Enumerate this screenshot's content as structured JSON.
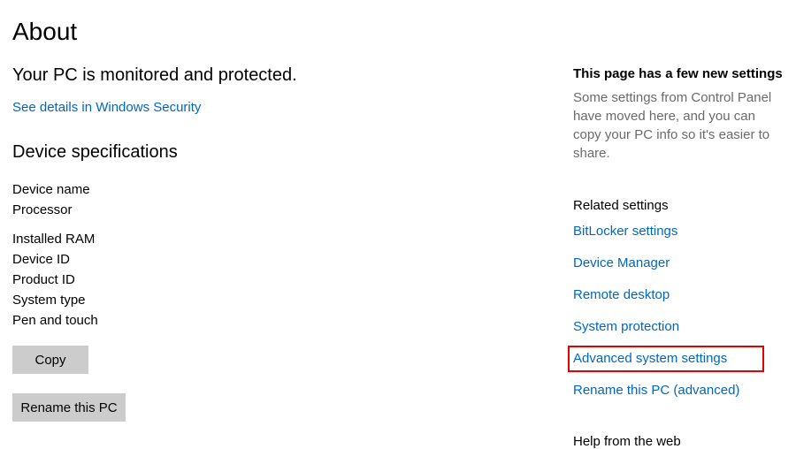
{
  "title": "About",
  "monitor_heading": "Your PC is monitored and protected.",
  "security_link": "See details in Windows Security",
  "device_specs": {
    "title": "Device specifications",
    "rows1": [
      "Device name",
      "Processor"
    ],
    "rows2": [
      "Installed RAM",
      "Device ID",
      "Product ID",
      "System type",
      "Pen and touch"
    ]
  },
  "buttons": {
    "copy": "Copy",
    "rename": "Rename this PC"
  },
  "side": {
    "heading": "This page has a few new settings",
    "desc": "Some settings from Control Panel have moved here, and you can copy your PC info so it's easier to share.",
    "related_title": "Related settings",
    "links": [
      "BitLocker settings",
      "Device Manager",
      "Remote desktop",
      "System protection",
      "Advanced system settings",
      "Rename this PC (advanced)"
    ],
    "highlighted_index": 4,
    "help": "Help from the web"
  }
}
